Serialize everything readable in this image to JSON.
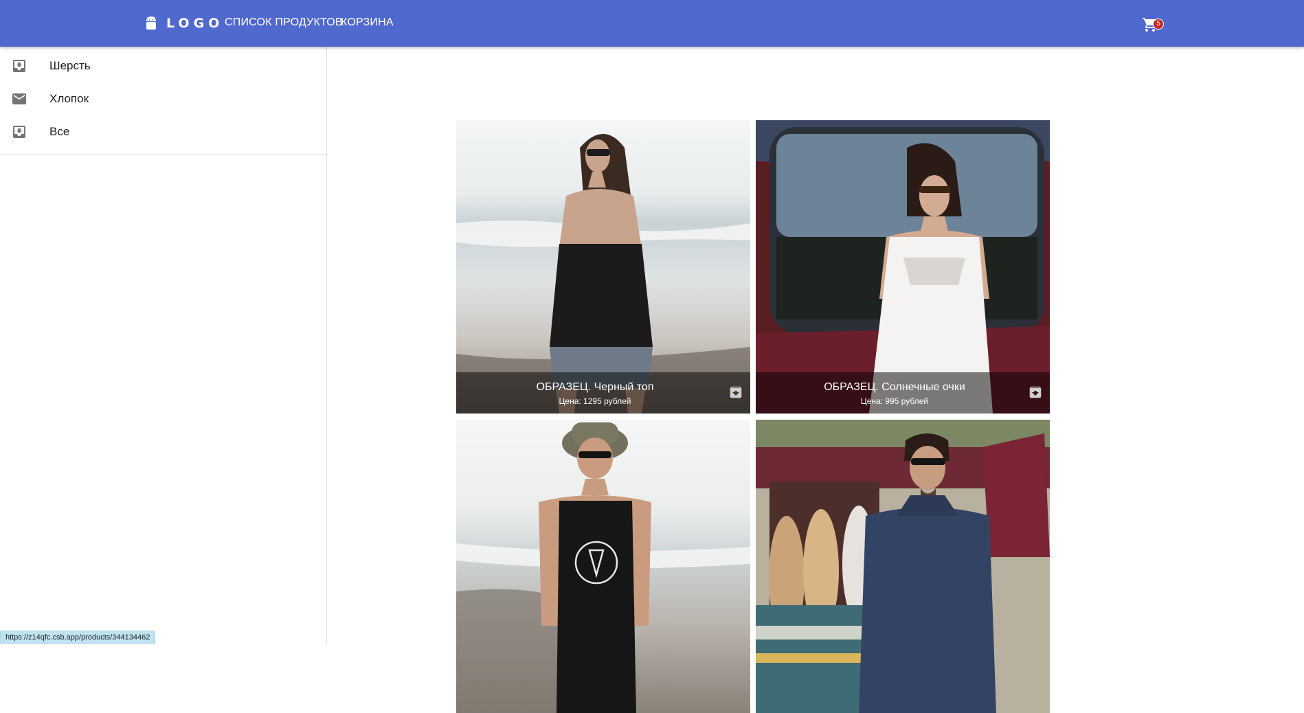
{
  "header": {
    "logo_text": "LOGO",
    "nav": [
      {
        "label": "СПИСОК ПРОДУКТОВ"
      },
      {
        "label": "КОРЗИНА"
      }
    ],
    "cart_icon": "shopping-cart-icon",
    "cart_count": "5",
    "colors": {
      "appbar": "#5069cf",
      "badge": "#c62828"
    }
  },
  "sidebar": {
    "items": [
      {
        "label": "Шерсть",
        "icon": "move-to-inbox-icon"
      },
      {
        "label": "Хлопок",
        "icon": "mail-icon"
      },
      {
        "label": "Все",
        "icon": "move-to-inbox-icon"
      }
    ]
  },
  "products": [
    {
      "title": "ОБРАЗЕЦ. Черный топ",
      "price": "Цена: 1295 рублей",
      "action_icon": "archive-icon"
    },
    {
      "title": "ОБРАЗЕЦ. Солнечные очки",
      "price": "Цена: 995 рублей",
      "action_icon": "archive-icon"
    },
    {
      "title": "",
      "price": ""
    },
    {
      "title": "",
      "price": ""
    }
  ],
  "status_bar": {
    "url": "https://z14qfc.csb.app/products/344134462"
  }
}
